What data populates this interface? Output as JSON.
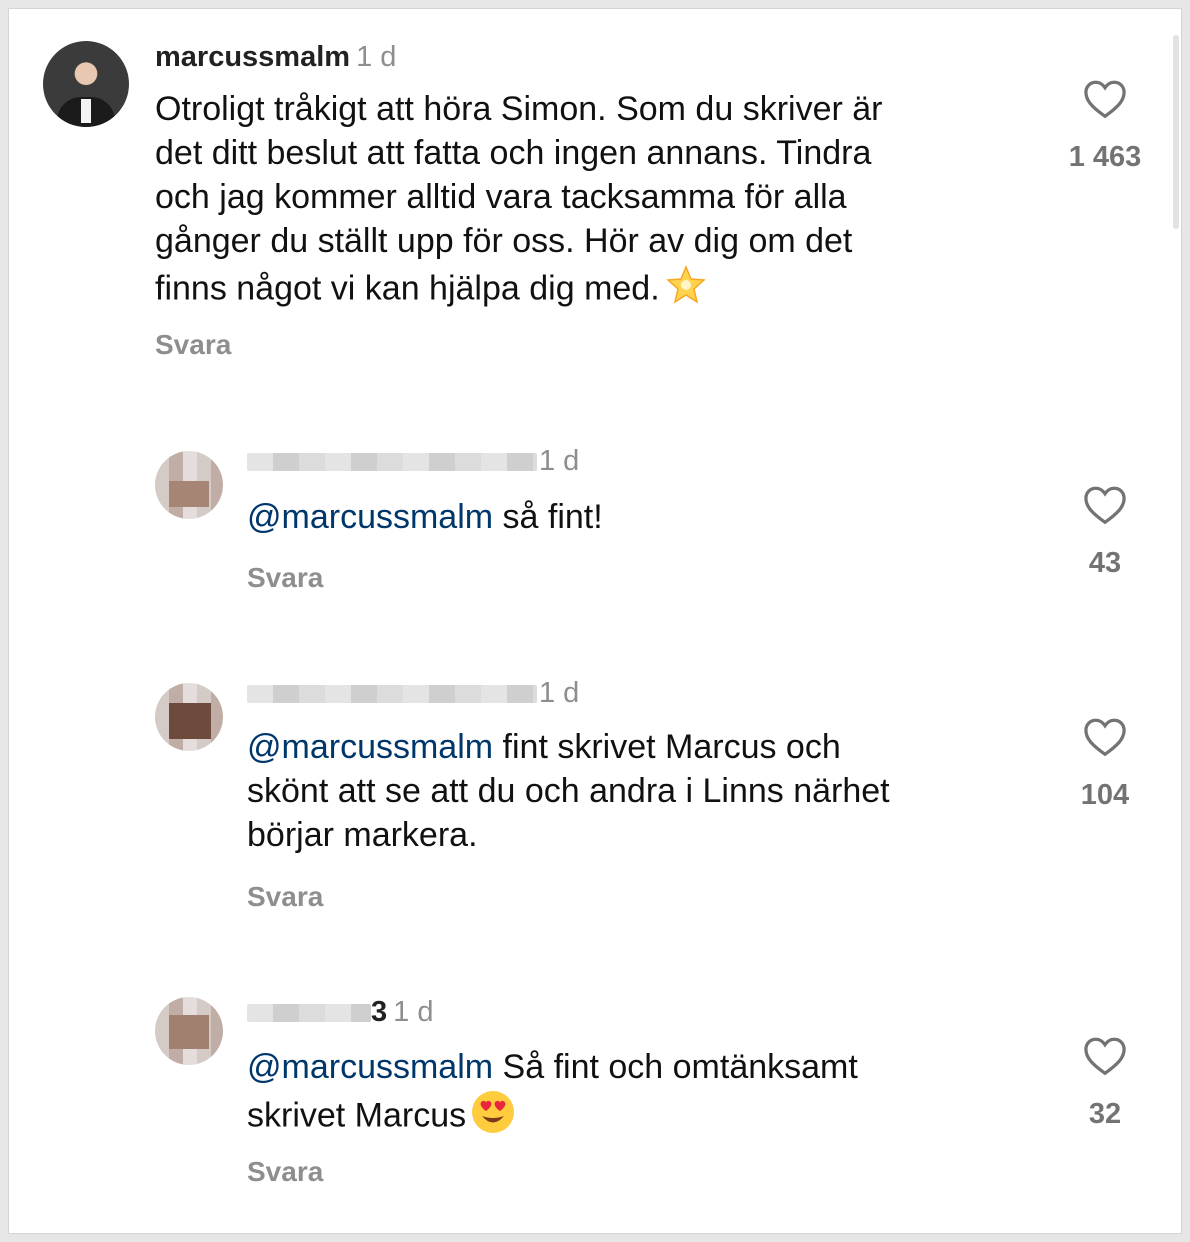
{
  "comments": [
    {
      "username": "marcussmalm",
      "time": "1 d",
      "lines": [
        "Otroligt tråkigt att höra Simon. Som du skriver är",
        "det ditt beslut att fatta och ingen annans.  Tindra",
        "och jag kommer alltid vara tacksamma för alla",
        "gånger du ställt upp för oss. Hör av dig om det",
        "finns något vi kan hjälpa dig med."
      ],
      "emoji": "glowing-star-icon",
      "reply_label": "Svara",
      "likes": "1 463"
    },
    {
      "username_suffix": "",
      "time": "1 d",
      "mention": "@marcussmalm",
      "text": " så fint!",
      "reply_label": "Svara",
      "likes": "43"
    },
    {
      "username_suffix": "",
      "time": "1 d",
      "mention": "@marcussmalm",
      "text": " fint skrivet Marcus och",
      "lines": [
        "skönt att se att du och andra i Linns närhet",
        "börjar markera."
      ],
      "reply_label": "Svara",
      "likes": "104"
    },
    {
      "username_suffix": "3",
      "time": "1 d",
      "mention": "@marcussmalm",
      "text": " Så fint och omtänksamt",
      "lines": [
        "skrivet Marcus"
      ],
      "emoji": "heart-eyes-face-icon",
      "reply_label": "Svara",
      "likes": "32"
    }
  ],
  "colors": {
    "mention": "#00376b",
    "muted": "#8e8e8e",
    "text": "#111111"
  }
}
